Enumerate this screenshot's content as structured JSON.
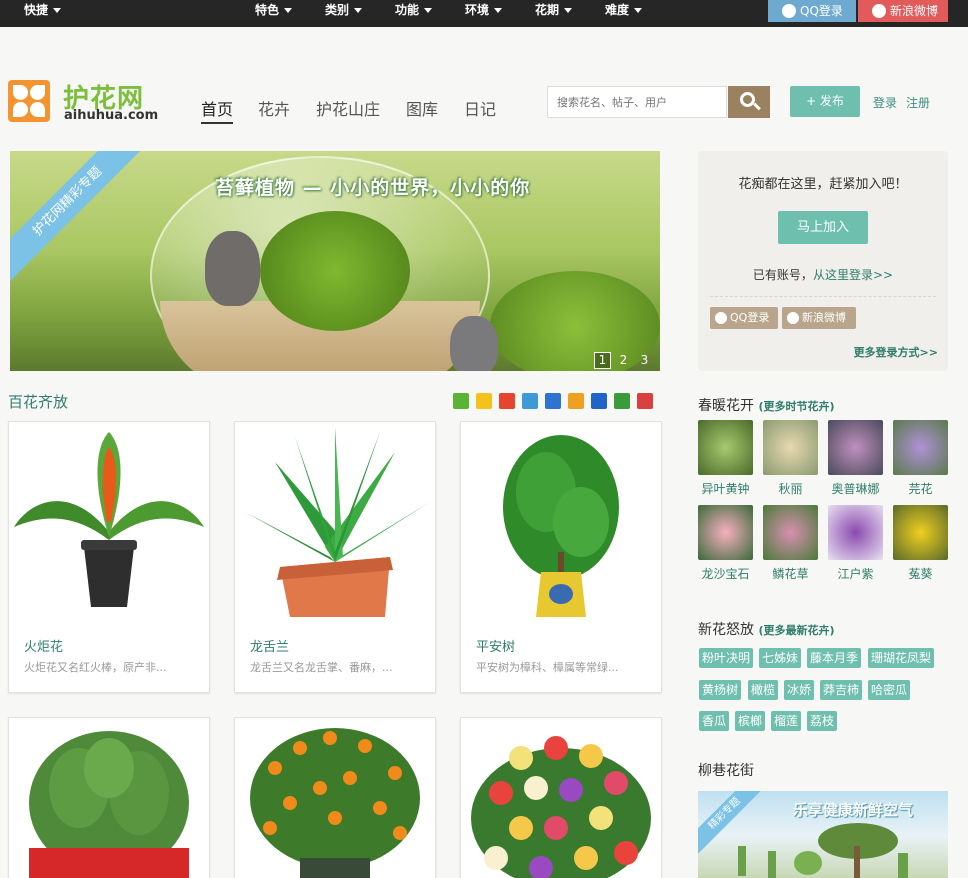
{
  "topbar": {
    "menus": [
      "快捷",
      "特色",
      "类别",
      "功能",
      "环境",
      "花期",
      "难度"
    ],
    "qq_login": "QQ登录",
    "weibo_login": "新浪微博"
  },
  "header": {
    "logo_name": "护花网",
    "logo_domain": "aihuhua.com",
    "nav": [
      "首页",
      "花卉",
      "护花山庄",
      "图库",
      "日记"
    ],
    "search_placeholder": "搜索花名、帖子、用户",
    "publish_label": "+ 发布",
    "login_label": "登录",
    "register_label": "注册"
  },
  "banner": {
    "ribbon": "护花网精彩专题",
    "caption": "苔藓植物 — 小小的世界，小小的你",
    "pages": [
      "1",
      "2",
      "3"
    ],
    "active_page": "1"
  },
  "main": {
    "section_title": "百花齐放",
    "share_icons": [
      "wechat-icon",
      "qzone-icon",
      "weibo-icon",
      "tencent-weibo-icon",
      "tieba-icon",
      "kaixin-icon",
      "renren-icon",
      "douban-icon",
      "youdao-icon"
    ],
    "cards": [
      {
        "name": "火炬花",
        "desc": "火炬花又名红火棒，原产非..."
      },
      {
        "name": "龙舌兰",
        "desc": "龙舌兰又名龙舌掌、番麻，..."
      },
      {
        "name": "平安树",
        "desc": "平安树为樟科、樟属等常绿..."
      },
      {
        "name": "",
        "desc": ""
      },
      {
        "name": "",
        "desc": ""
      },
      {
        "name": "",
        "desc": ""
      }
    ]
  },
  "sidebar": {
    "join_text": "花痴都在这里，赶紧加入吧！",
    "join_button": "马上加入",
    "have_account": "已有账号，",
    "login_here": "从这里登录>>",
    "qq_login": "QQ登录",
    "weibo_login": "新浪微博",
    "more_login": "更多登录方式>>",
    "spring_title": "春暖花开",
    "spring_more": "(更多时节花卉)",
    "spring_flowers": [
      "异叶黄钟",
      "秋丽",
      "奥普琳娜",
      "芫花",
      "龙沙宝石",
      "鳞花草",
      "江户紫",
      "菟葵"
    ],
    "new_title": "新花怒放",
    "new_more": "(更多最新花卉)",
    "new_tags": [
      "粉叶决明",
      "七姊妹",
      "藤本月季",
      "珊瑚花凤梨",
      "黄杨树",
      "橄榄",
      "冰娇",
      "莽吉柿",
      "哈密瓜",
      "香瓜",
      "槟榔",
      "榴莲",
      "荔枝"
    ],
    "street_title": "柳巷花街",
    "street_ribbon": "精彩专题",
    "street_caption": "乐享健康新鲜空气"
  },
  "colors": {
    "accent": "#6ebfae",
    "link": "#2f7d6a",
    "topbar": "#262626",
    "qq": "#6ea9cf",
    "weibo": "#e25a5a",
    "search_button": "#9a8160"
  }
}
